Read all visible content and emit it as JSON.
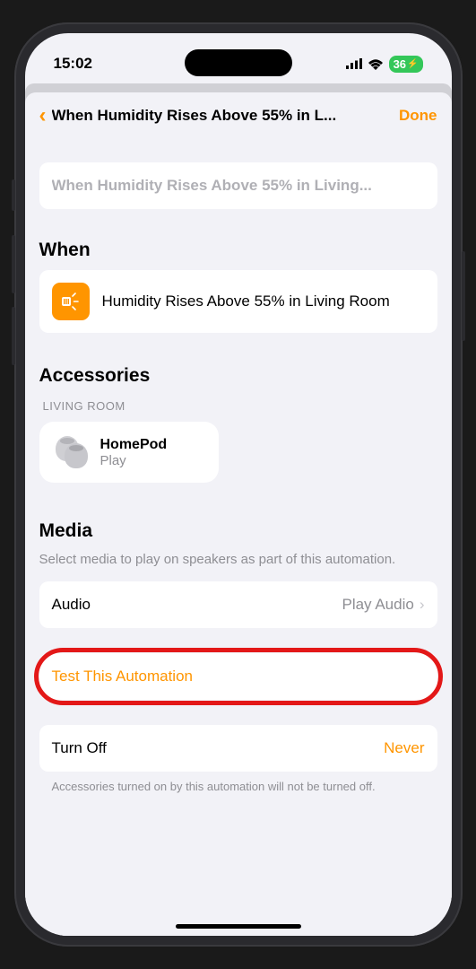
{
  "status_bar": {
    "time": "15:02",
    "battery": "36"
  },
  "nav": {
    "title": "When Humidity Rises Above 55% in L...",
    "done": "Done"
  },
  "name_field": "When Humidity Rises Above 55% in Living...",
  "when": {
    "section": "When",
    "text": "Humidity Rises Above 55% in Living Room"
  },
  "accessories": {
    "section": "Accessories",
    "group": "LIVING ROOM",
    "name": "HomePod",
    "action": "Play"
  },
  "media": {
    "section": "Media",
    "description": "Select media to play on speakers as part of this automation.",
    "label": "Audio",
    "value": "Play Audio"
  },
  "test_button": "Test This Automation",
  "turn_off": {
    "label": "Turn Off",
    "value": "Never",
    "note": "Accessories turned on by this automation will not be turned off."
  }
}
